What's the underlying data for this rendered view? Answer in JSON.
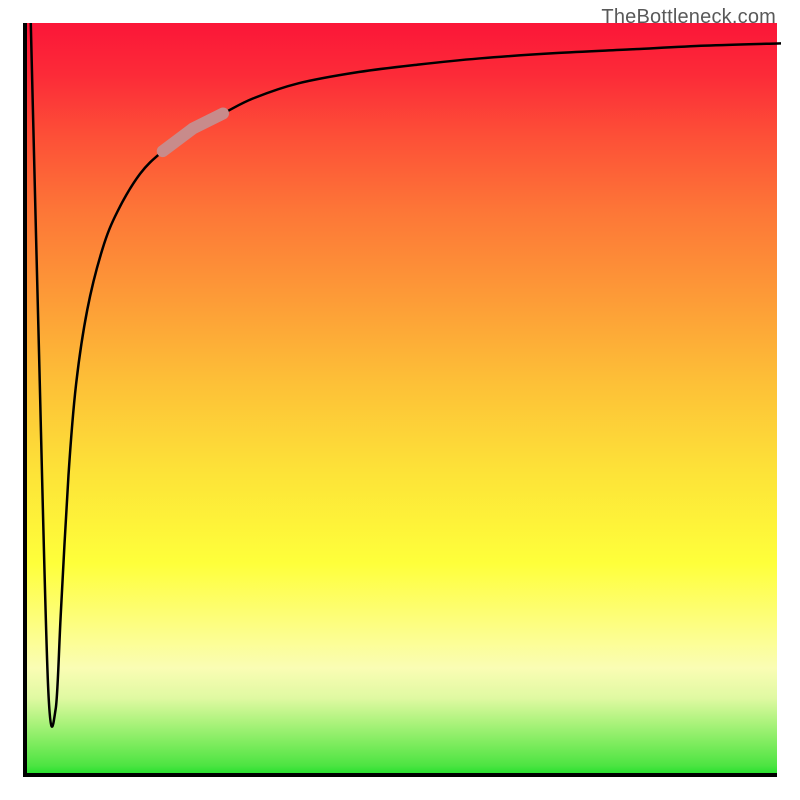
{
  "watermark": "TheBottleneck.com",
  "chart_data": {
    "type": "line",
    "title": "",
    "xlabel": "",
    "ylabel": "",
    "xlim": [
      0,
      100
    ],
    "ylim": [
      0,
      100
    ],
    "grid": false,
    "series": [
      {
        "name": "curve",
        "x": [
          0.5,
          1.5,
          2.8,
          3.8,
          4.5,
          5.5,
          6.5,
          8,
          10,
          12,
          15,
          18,
          22,
          26,
          30,
          36,
          44,
          52,
          60,
          70,
          80,
          90,
          100
        ],
        "y": [
          100,
          60,
          12,
          9,
          22,
          40,
          52,
          62,
          70,
          75,
          80,
          83,
          86,
          88,
          90,
          92,
          93.5,
          94.5,
          95.3,
          96,
          96.5,
          97,
          97.3
        ]
      }
    ],
    "highlight_segment": {
      "x_range": [
        18,
        26
      ],
      "color": "#c88b8b"
    }
  }
}
